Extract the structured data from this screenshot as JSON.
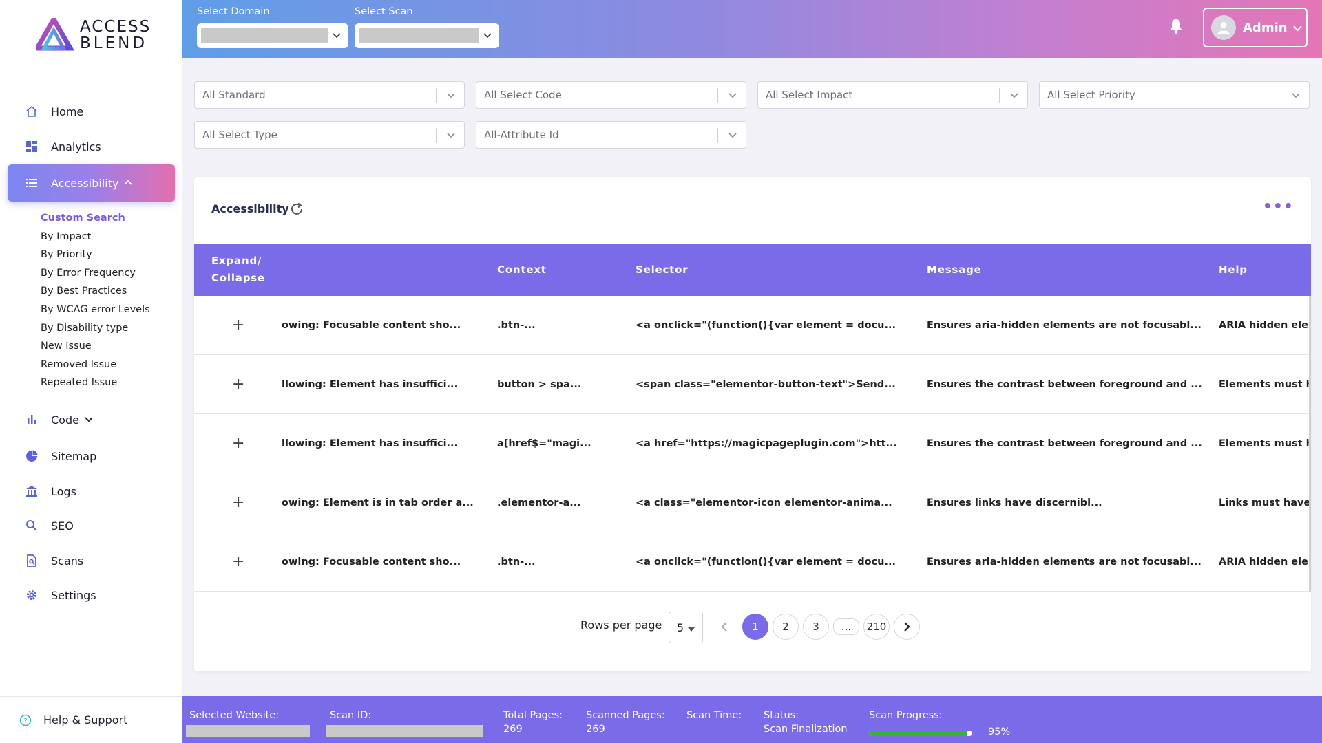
{
  "brand": {
    "line1": "ACCESS",
    "line2": "BLEND"
  },
  "sidebar": {
    "items": [
      {
        "label": "Home",
        "icon": "home-icon"
      },
      {
        "label": "Analytics",
        "icon": "analytics-icon"
      },
      {
        "label": "Accessibility",
        "icon": "list-icon"
      },
      {
        "label": "Code",
        "icon": "bar-chart-icon"
      },
      {
        "label": "Sitemap",
        "icon": "pie-chart-icon"
      },
      {
        "label": "Logs",
        "icon": "bank-icon"
      },
      {
        "label": "SEO",
        "icon": "search-icon"
      },
      {
        "label": "Scans",
        "icon": "scan-icon"
      },
      {
        "label": "Settings",
        "icon": "gear-icon"
      }
    ],
    "submenu": [
      "Custom Search",
      "By Impact",
      "By Priority",
      "By Error Frequency",
      "By Best Practices",
      "By WCAG error Levels",
      "By Disability type",
      "New Issue",
      "Removed Issue",
      "Repeated Issue"
    ],
    "help": "Help & Support"
  },
  "header": {
    "domain_label": "Select Domain",
    "scan_label": "Select Scan",
    "user": "Admin"
  },
  "filters": [
    "All Standard",
    "All Select Code",
    "All Select Impact",
    "All Select Priority",
    "All Select Type",
    "All-Attribute Id"
  ],
  "card": {
    "title": "Accessibility",
    "columns": [
      "Expand/",
      "Collapse",
      "Context",
      "Selector",
      "Message",
      "Help"
    ],
    "rows": [
      {
        "desc": "owing: Focusable content sho...",
        "context": ".btn-...",
        "selector": "<a onclick=\"(function(){var element = docu...",
        "message": "Ensures aria-hidden elements are not focusabl...",
        "help": "ARIA hidden eleme"
      },
      {
        "desc": "llowing: Element has insuffici...",
        "context": "button > spa...",
        "selector": "<span class=\"elementor-button-text\">Send...",
        "message": "Ensures the contrast between foreground and ...",
        "help": "Elements must hav"
      },
      {
        "desc": "llowing: Element has insuffici...",
        "context": "a[href$=\"magi...",
        "selector": "<a href=\"https://magicpageplugin.com\">htt...",
        "message": "Ensures the contrast between foreground and ...",
        "help": "Elements must hav"
      },
      {
        "desc": "owing: Element is in tab order a...",
        "context": ".elementor-a...",
        "selector": "<a class=\"elementor-icon elementor-anima...",
        "message": "Ensures links have discernibl...",
        "help": "Links must have di"
      },
      {
        "desc": "owing: Focusable content sho...",
        "context": ".btn-...",
        "selector": "<a onclick=\"(function(){var element = docu...",
        "message": "Ensures aria-hidden elements are not focusabl...",
        "help": "ARIA hidden eleme"
      }
    ],
    "rows_per_page_label": "Rows per page",
    "rows_per_page": "5",
    "pages": [
      "1",
      "2",
      "3",
      "...",
      "210"
    ]
  },
  "footer": {
    "website_label": "Selected Website:",
    "scanid_label": "Scan ID:",
    "total_label": "Total Pages:",
    "total_value": "269",
    "scanned_label": "Scanned Pages:",
    "scanned_value": "269",
    "time_label": "Scan Time:",
    "status_label": "Status:",
    "status_value": "Scan Finalization",
    "progress_label": "Scan Progress:",
    "progress_value": "95%",
    "progress_fraction": 0.95
  },
  "colors": {
    "accent": "#7a6be9",
    "progress": "#36b32f",
    "active_sub": "#7a5ae6"
  }
}
